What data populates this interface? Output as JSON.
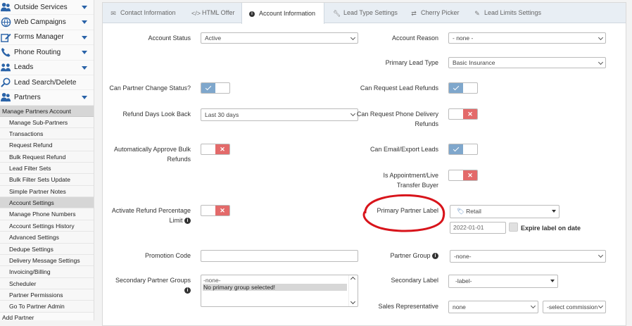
{
  "sidebar": {
    "nav": [
      {
        "label": "Outside Services",
        "icon": "users-icon",
        "caret": true
      },
      {
        "label": "Web Campaigns",
        "icon": "globe-icon",
        "caret": true
      },
      {
        "label": "Forms Manager",
        "icon": "edit-icon",
        "caret": true
      },
      {
        "label": "Phone Routing",
        "icon": "phone-icon",
        "caret": true
      },
      {
        "label": "Leads",
        "icon": "group-icon",
        "caret": true
      },
      {
        "label": "Lead Search/Delete",
        "icon": "search-icon",
        "caret": false
      },
      {
        "label": "Partners",
        "icon": "users-icon",
        "caret": true
      }
    ],
    "section_header": "Manage Partners Account",
    "sub_items": [
      "Manage Sub-Partners",
      "Transactions",
      "Request Refund",
      "Bulk Request Refund",
      "Lead Filter Sets",
      "Bulk Filter Sets Update",
      "Simple Partner Notes",
      "Account Settings",
      "Manage Phone Numbers",
      "Account Settings History",
      "Advanced Settings",
      "Dedupe Settings",
      "Delivery Message Settings",
      "Invoicing/Billing",
      "Scheduler",
      "Partner Permissions",
      "Go To Partner Admin"
    ],
    "active_sub_item": "Account Settings",
    "add_partner": "Add Partner"
  },
  "tabs": [
    {
      "label": "Contact Information",
      "icon": "envelope-icon"
    },
    {
      "label": "HTML Offer",
      "icon": "code-icon"
    },
    {
      "label": "Account Information",
      "icon": "info-icon"
    },
    {
      "label": "Lead Type Settings",
      "icon": "wrench-icon"
    },
    {
      "label": "Cherry Picker",
      "icon": "shuffle-icon"
    },
    {
      "label": "Lead Limits Settings",
      "icon": "pin-icon"
    }
  ],
  "active_tab": "Account Information",
  "form": {
    "account_status": {
      "label": "Account Status",
      "value": "Active"
    },
    "account_reason": {
      "label": "Account Reason",
      "value": "- none -"
    },
    "primary_lead_type": {
      "label": "Primary Lead Type",
      "value": "Basic Insurance"
    },
    "can_partner_change_status": {
      "label": "Can Partner Change Status?",
      "on": true
    },
    "can_request_lead_refunds": {
      "label": "Can Request Lead Refunds",
      "on": true
    },
    "refund_days_look_back": {
      "label": "Refund Days Look Back",
      "value": "Last 30 days"
    },
    "can_request_phone_delivery_refunds": {
      "label": "Can Request Phone Delivery Refunds",
      "on": false
    },
    "auto_approve_bulk_refunds": {
      "label": "Automatically Approve Bulk Refunds",
      "on": false
    },
    "can_email_export_leads": {
      "label": "Can Email/Export Leads",
      "on": true
    },
    "is_appointment_live_transfer": {
      "label": "Is Appointment/Live Transfer Buyer",
      "on": false
    },
    "activate_refund_percentage_limit": {
      "label": "Activate Refund Percentage Limit",
      "on": false
    },
    "primary_partner_label": {
      "label": "Primary Partner Label",
      "value": "Retail",
      "date": "2022-01-01",
      "expire_label": "Expire label on date"
    },
    "promotion_code": {
      "label": "Promotion Code",
      "value": ""
    },
    "partner_group": {
      "label": "Partner Group",
      "value": "-none-"
    },
    "secondary_partner_groups": {
      "label": "Secondary Partner Groups",
      "options": [
        "-none-",
        "No primary group selected!"
      ]
    },
    "secondary_label": {
      "label": "Secondary Label",
      "value": "-label-"
    },
    "sales_representative": {
      "label": "Sales Representative",
      "value": "none",
      "commission_value": "-select commission"
    }
  },
  "colors": {
    "annotation_circle": "#d8141b",
    "toggle_on": "#7fa7cc",
    "toggle_off": "#e36a6a"
  }
}
